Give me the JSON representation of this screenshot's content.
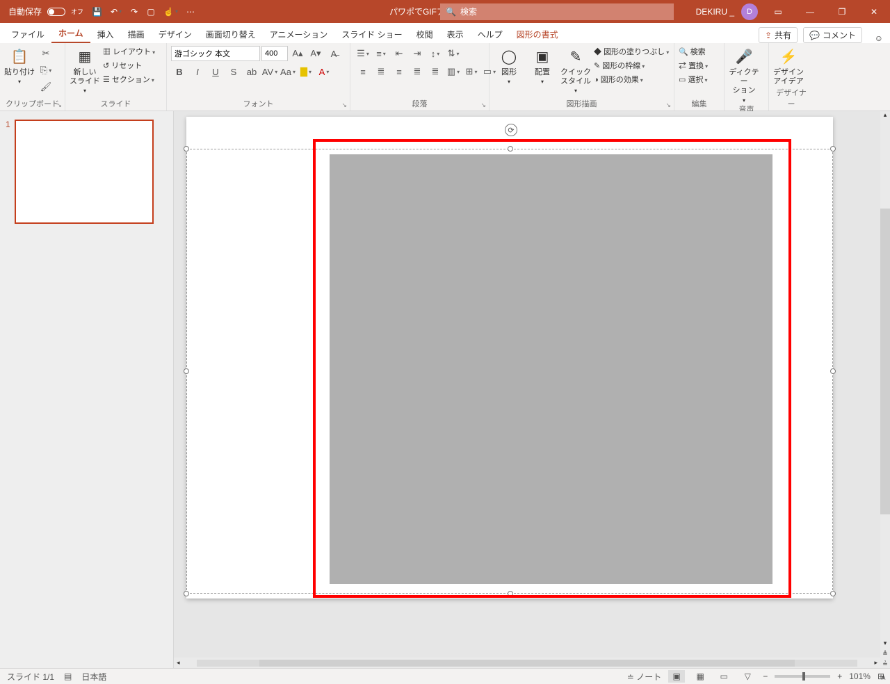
{
  "titlebar": {
    "autosave_label": "自動保存",
    "autosave_state": "オフ",
    "doc_title": "パワポでGIFアニメーション",
    "search_placeholder": "検索",
    "user_name": "DEKIRU _",
    "avatar_letter": "D"
  },
  "tabs": {
    "file": "ファイル",
    "home": "ホーム",
    "insert": "挿入",
    "draw": "描画",
    "design": "デザイン",
    "transitions": "画面切り替え",
    "animations": "アニメーション",
    "slideshow": "スライド ショー",
    "review": "校閲",
    "view": "表示",
    "help": "ヘルプ",
    "shapeformat": "図形の書式",
    "share": "共有",
    "comments": "コメント"
  },
  "ribbon": {
    "clipboard": {
      "label": "クリップボード",
      "paste": "貼り付け"
    },
    "slides": {
      "label": "スライド",
      "new": "新しい\nスライド",
      "layout": "レイアウト",
      "reset": "リセット",
      "section": "セクション"
    },
    "font": {
      "label": "フォント",
      "name": "游ゴシック 本文",
      "size": "400"
    },
    "paragraph": {
      "label": "段落"
    },
    "drawing": {
      "label": "図形描画",
      "shapes": "図形",
      "arrange": "配置",
      "quick": "クイック\nスタイル",
      "fill": "図形の塗りつぶし",
      "outline": "図形の枠線",
      "effects": "図形の効果"
    },
    "editing": {
      "label": "編集",
      "find": "検索",
      "replace": "置換",
      "select": "選択"
    },
    "voice": {
      "label": "音声",
      "dictate": "ディクテー\nション"
    },
    "designer": {
      "label": "デザイナー",
      "ideas": "デザイン\nアイデア"
    }
  },
  "thumb": {
    "num": "1"
  },
  "status": {
    "slide_of": "スライド 1/1",
    "lang": "日本語",
    "notes": "ノート",
    "zoom": "101%"
  }
}
